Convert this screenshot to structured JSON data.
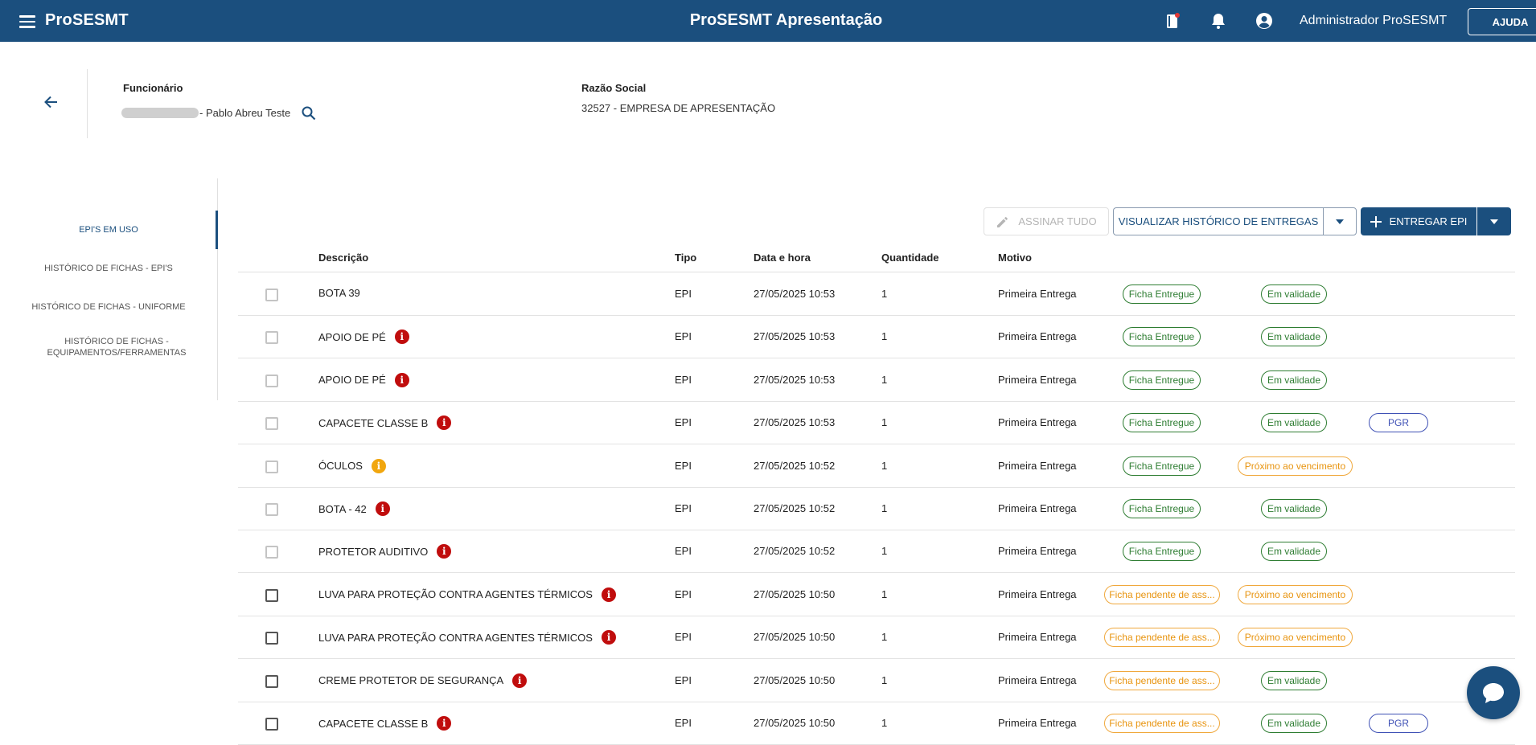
{
  "topbar": {
    "brand": "ProSESMT",
    "title": "ProSESMT Apresentação",
    "user": "Administrador ProSESMT",
    "help_label": "AJUDA",
    "icons": [
      "menu-icon",
      "notebook-icon",
      "bell-icon",
      "account-circle-icon"
    ]
  },
  "header": {
    "employee_label": "Funcionário",
    "employee_value": "- Pablo Abreu Teste",
    "company_label": "Razão Social",
    "company_value": "32527 - EMPRESA DE APRESENTAÇÃO"
  },
  "sidenav": {
    "items": [
      {
        "label": "EPI'S EM USO",
        "active": true
      },
      {
        "label": "HISTÓRICO DE FICHAS - EPI'S",
        "active": false
      },
      {
        "label": "HISTÓRICO DE FICHAS - UNIFORME",
        "active": false
      },
      {
        "label": "HISTÓRICO DE FICHAS - EQUIPAMENTOS/FERRAMENTAS",
        "active": false
      }
    ]
  },
  "toolbar": {
    "sign_all": "ASSINAR TUDO",
    "view_history": "VISUALIZAR HISTÓRICO DE ENTREGAS",
    "deliver": "ENTREGAR EPI"
  },
  "table": {
    "columns": [
      "Descrição",
      "Tipo",
      "Data e hora",
      "Quantidade",
      "Motivo"
    ],
    "rows": [
      {
        "desc": "BOTA 39",
        "info": "",
        "tipo": "EPI",
        "data": "27/05/2025 10:53",
        "qtd": "1",
        "motivo": "Primeira Entrega",
        "ficha": "Ficha Entregue",
        "ficha_color": "green",
        "validade": "Em validade",
        "validade_color": "green",
        "pgr": "",
        "checkbox_enabled": false
      },
      {
        "desc": "APOIO DE PÉ",
        "info": "red",
        "tipo": "EPI",
        "data": "27/05/2025 10:53",
        "qtd": "1",
        "motivo": "Primeira Entrega",
        "ficha": "Ficha Entregue",
        "ficha_color": "green",
        "validade": "Em validade",
        "validade_color": "green",
        "pgr": "",
        "checkbox_enabled": false
      },
      {
        "desc": "APOIO DE PÉ",
        "info": "red",
        "tipo": "EPI",
        "data": "27/05/2025 10:53",
        "qtd": "1",
        "motivo": "Primeira Entrega",
        "ficha": "Ficha Entregue",
        "ficha_color": "green",
        "validade": "Em validade",
        "validade_color": "green",
        "pgr": "",
        "checkbox_enabled": false
      },
      {
        "desc": "CAPACETE CLASSE B",
        "info": "red",
        "tipo": "EPI",
        "data": "27/05/2025 10:53",
        "qtd": "1",
        "motivo": "Primeira Entrega",
        "ficha": "Ficha Entregue",
        "ficha_color": "green",
        "validade": "Em validade",
        "validade_color": "green",
        "pgr": "PGR",
        "checkbox_enabled": false
      },
      {
        "desc": "ÓCULOS",
        "info": "amber",
        "tipo": "EPI",
        "data": "27/05/2025 10:52",
        "qtd": "1",
        "motivo": "Primeira Entrega",
        "ficha": "Ficha Entregue",
        "ficha_color": "green",
        "validade": "Próximo ao vencimento",
        "validade_color": "orange",
        "pgr": "",
        "checkbox_enabled": false
      },
      {
        "desc": "BOTA - 42",
        "info": "red",
        "tipo": "EPI",
        "data": "27/05/2025 10:52",
        "qtd": "1",
        "motivo": "Primeira Entrega",
        "ficha": "Ficha Entregue",
        "ficha_color": "green",
        "validade": "Em validade",
        "validade_color": "green",
        "pgr": "",
        "checkbox_enabled": false
      },
      {
        "desc": "PROTETOR AUDITIVO",
        "info": "red",
        "tipo": "EPI",
        "data": "27/05/2025 10:52",
        "qtd": "1",
        "motivo": "Primeira Entrega",
        "ficha": "Ficha Entregue",
        "ficha_color": "green",
        "validade": "Em validade",
        "validade_color": "green",
        "pgr": "",
        "checkbox_enabled": false
      },
      {
        "desc": "LUVA PARA PROTEÇÃO CONTRA AGENTES TÉRMICOS",
        "info": "red",
        "tipo": "EPI",
        "data": "27/05/2025 10:50",
        "qtd": "1",
        "motivo": "Primeira Entrega",
        "ficha": "Ficha pendente de ass...",
        "ficha_color": "orange",
        "validade": "Próximo ao vencimento",
        "validade_color": "orange",
        "pgr": "",
        "checkbox_enabled": true
      },
      {
        "desc": "LUVA PARA PROTEÇÃO CONTRA AGENTES TÉRMICOS",
        "info": "red",
        "tipo": "EPI",
        "data": "27/05/2025 10:50",
        "qtd": "1",
        "motivo": "Primeira Entrega",
        "ficha": "Ficha pendente de ass...",
        "ficha_color": "orange",
        "validade": "Próximo ao vencimento",
        "validade_color": "orange",
        "pgr": "",
        "checkbox_enabled": true
      },
      {
        "desc": "CREME PROTETOR DE SEGURANÇA",
        "info": "red",
        "tipo": "EPI",
        "data": "27/05/2025 10:50",
        "qtd": "1",
        "motivo": "Primeira Entrega",
        "ficha": "Ficha pendente de ass...",
        "ficha_color": "orange",
        "validade": "Em validade",
        "validade_color": "green",
        "pgr": "",
        "checkbox_enabled": true
      },
      {
        "desc": "CAPACETE CLASSE B",
        "info": "red",
        "tipo": "EPI",
        "data": "27/05/2025 10:50",
        "qtd": "1",
        "motivo": "Primeira Entrega",
        "ficha": "Ficha pendente de ass...",
        "ficha_color": "orange",
        "validade": "Em validade",
        "validade_color": "green",
        "pgr": "PGR",
        "checkbox_enabled": true
      }
    ]
  },
  "colors": {
    "primary": "#1b4f7e",
    "success": "#2e7d32",
    "warning": "#e8940f",
    "danger": "#c00d0d",
    "info_badge": "#3f51b5"
  }
}
